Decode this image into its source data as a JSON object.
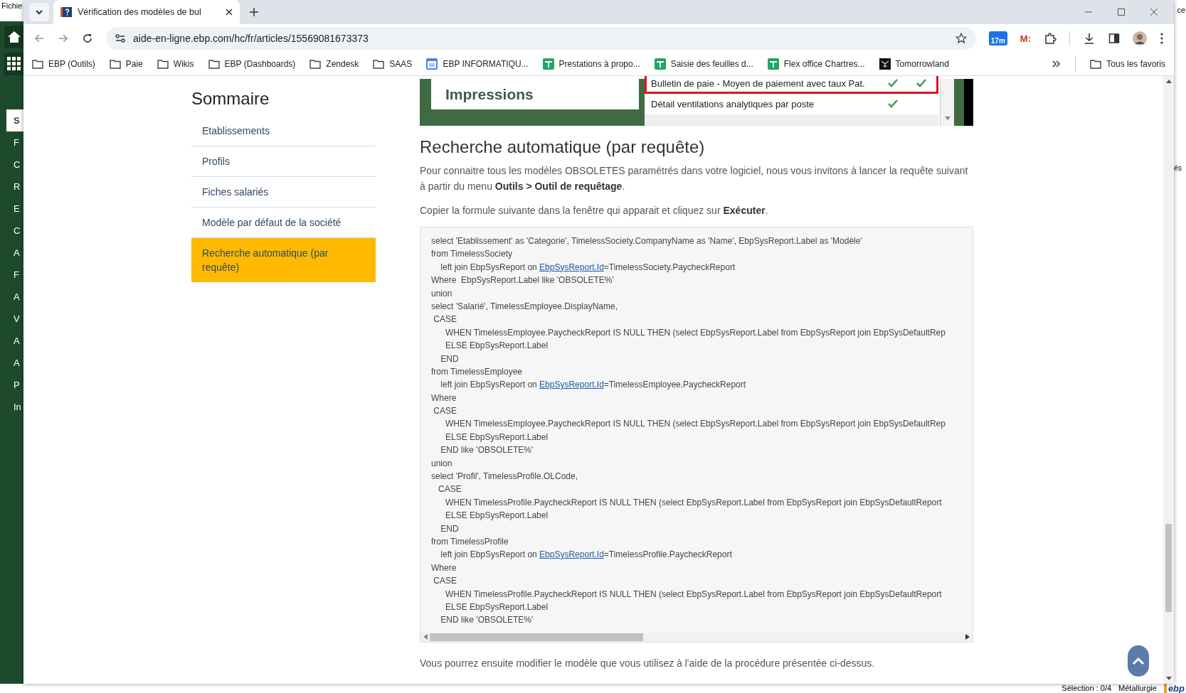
{
  "background_app": {
    "menu_label": "Fichie",
    "nav_letters": [
      {
        "text": "S",
        "selected": true
      },
      {
        "text": "F",
        "selected": false
      },
      {
        "text": "C",
        "selected": false
      },
      {
        "text": "R",
        "selected": false
      },
      {
        "text": "E",
        "selected": false
      },
      {
        "text": "C",
        "selected": false
      },
      {
        "text": "A",
        "selected": false
      },
      {
        "text": "F",
        "selected": false
      },
      {
        "text": "A",
        "selected": false
      },
      {
        "text": "V",
        "selected": false
      },
      {
        "text": "A",
        "selected": false
      },
      {
        "text": "A",
        "selected": false
      },
      {
        "text": "P",
        "selected": false
      },
      {
        "text": "In",
        "selected": false
      }
    ],
    "right_texts": [
      "ce",
      "és"
    ],
    "status": {
      "selection": "Sélection : 0/4",
      "profile": "Métallurgie",
      "logo": "ebp"
    }
  },
  "browser": {
    "tabs": [
      {
        "title": "Vérification des modèles de bul",
        "selected": true
      }
    ],
    "url": "aide-en-ligne.ebp.com/hc/fr/articles/15569081673373",
    "extension_badge": "17m",
    "extension_label": "M:",
    "bookmarks": [
      {
        "label": "EBP (Outils)",
        "kind": "folder"
      },
      {
        "label": "Paie",
        "kind": "folder"
      },
      {
        "label": "Wikis",
        "kind": "folder"
      },
      {
        "label": "EBP (Dashboards)",
        "kind": "folder"
      },
      {
        "label": "Zendesk",
        "kind": "folder"
      },
      {
        "label": "SAAS",
        "kind": "folder"
      },
      {
        "label": "EBP INFORMATIQU...",
        "kind": "calendar"
      },
      {
        "label": "Prestations à propo...",
        "kind": "sheet"
      },
      {
        "label": "Saisie des feuilles d...",
        "kind": "sheet"
      },
      {
        "label": "Flex office Chartres...",
        "kind": "sheet"
      },
      {
        "label": "Tomorrowland",
        "kind": "emblem"
      }
    ],
    "all_bookmarks": "Tous les favoris"
  },
  "sommaire": {
    "title": "Sommaire",
    "items": [
      {
        "label": "Etablissements",
        "selected": false
      },
      {
        "label": "Profils",
        "selected": false
      },
      {
        "label": "Fiches salariés",
        "selected": false
      },
      {
        "label": "Modèle par défaut de la société",
        "selected": false
      },
      {
        "label": "Recherche automatique (par requête)",
        "selected": true
      }
    ]
  },
  "article": {
    "figure": {
      "section_label": "Impressions",
      "rows": [
        {
          "label": "Bulletin de paie - Moyen de paiement avec taux Pat.",
          "highlighted": true,
          "checked": [
            true,
            true
          ]
        },
        {
          "label": "Détail ventilations analytiques par poste",
          "highlighted": false,
          "checked": [
            true,
            false
          ]
        }
      ]
    },
    "heading": "Recherche automatique (par requête)",
    "intro": "Pour connaitre tous les modèles OBSOLETES paramétrés dans votre logiciel, nous vous invitons à lancer la requête suivant à partir du menu **Outils > Outil de requêtage**.",
    "instruction": "Copier la formule suivante dans la fenêtre qui apparait et cliquez sur **Exécuter**.",
    "code_lines": [
      {
        "text": "select 'Etablissement' as 'Categorie', TimelessSociety.CompanyName as 'Name', EbpSysReport.Label as 'Modèle'"
      },
      {
        "text": "from TimelessSociety"
      },
      {
        "text": "    left join EbpSysReport on ",
        "link": "EbpSysReport.Id",
        "after": "=TimelessSociety.PaycheckReport"
      },
      {
        "text": "Where  EbpSysReport.Label like 'OBSOLETE%'"
      },
      {
        "text": "union"
      },
      {
        "text": "select 'Salarié', TimelessEmployee.DisplayName,"
      },
      {
        "text": " CASE"
      },
      {
        "text": "      WHEN TimelessEmployee.PaycheckReport IS NULL THEN (select EbpSysReport.Label from EbpSysReport join EbpSysDefaultRep"
      },
      {
        "text": "      ELSE EbpSysReport.Label"
      },
      {
        "text": "    END"
      },
      {
        "text": "from TimelessEmployee"
      },
      {
        "text": "    left join EbpSysReport on ",
        "link": "EbpSysReport.Id",
        "after": "=TimelessEmployee.PaycheckReport"
      },
      {
        "text": "Where"
      },
      {
        "text": " CASE"
      },
      {
        "text": "      WHEN TimelessEmployee.PaycheckReport IS NULL THEN (select EbpSysReport.Label from EbpSysReport join EbpSysDefaultRep"
      },
      {
        "text": "      ELSE EbpSysReport.Label"
      },
      {
        "text": "    END like 'OBSOLETE%'"
      },
      {
        "text": "union"
      },
      {
        "text": "select 'Profil', TimelessProfile.OLCode,"
      },
      {
        "text": "   CASE"
      },
      {
        "text": "      WHEN TimelessProfile.PaycheckReport IS NULL THEN (select EbpSysReport.Label from EbpSysReport join EbpSysDefaultReport"
      },
      {
        "text": "      ELSE EbpSysReport.Label"
      },
      {
        "text": "    END"
      },
      {
        "text": "from TimelessProfile"
      },
      {
        "text": "    left join EbpSysReport on ",
        "link": "EbpSysReport.Id",
        "after": "=TimelessProfile.PaycheckReport"
      },
      {
        "text": "Where"
      },
      {
        "text": " CASE"
      },
      {
        "text": "      WHEN TimelessProfile.PaycheckReport IS NULL THEN (select EbpSysReport.Label from EbpSysReport join EbpSysDefaultReport"
      },
      {
        "text": "      ELSE EbpSysReport.Label"
      },
      {
        "text": "    END like 'OBSOLETE%'"
      }
    ],
    "footer_text": "Vous pourrez ensuite modifier le modèle que vous utilisez à l'aide de la procédure présentée ci-dessus."
  }
}
